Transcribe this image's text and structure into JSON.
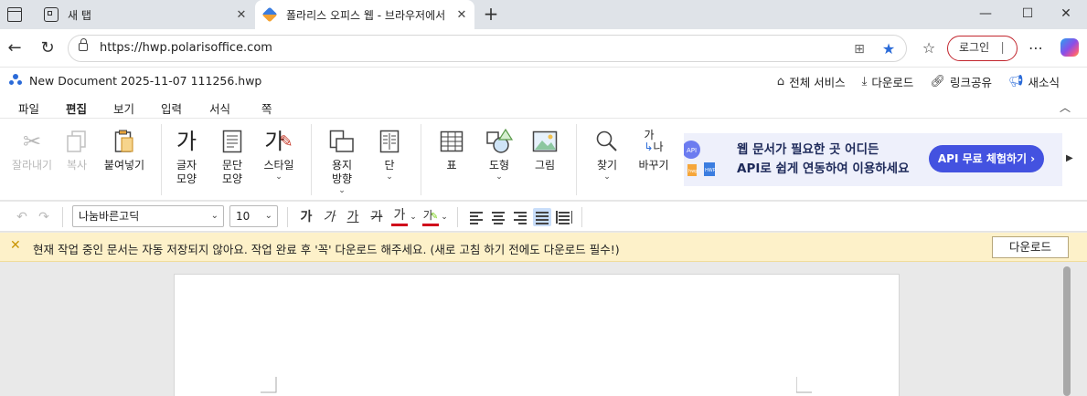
{
  "browser": {
    "tabs": [
      {
        "title": "새 탭",
        "favicon": "new-tab-icon"
      },
      {
        "title": "폴라리스 오피스 웹 - 브라우저에서",
        "favicon": "polaris-office-icon",
        "active": true
      }
    ],
    "url": "https://hwp.polarisoffice.com",
    "login_label": "로그인",
    "window_controls": {
      "minimize": "—",
      "maximize": "☐",
      "close": "✕"
    }
  },
  "app": {
    "doc_title": "New Document 2025-11-07 111256.hwp",
    "header_links": [
      {
        "label": "전체 서비스",
        "icon": "home-icon"
      },
      {
        "label": "다운로드",
        "icon": "download-icon"
      },
      {
        "label": "링크공유",
        "icon": "link-icon"
      },
      {
        "label": "새소식",
        "icon": "megaphone-icon"
      }
    ],
    "menu": [
      "파일",
      "편집",
      "보기",
      "입력",
      "서식",
      "쪽"
    ],
    "active_menu": "편집"
  },
  "ribbon": {
    "cut": "잘라내기",
    "copy": "복사",
    "paste": "붙여넣기",
    "char_shape": [
      "글자",
      "모양"
    ],
    "para_shape": [
      "문단",
      "모양"
    ],
    "style": "스타일",
    "page_orient": [
      "용지",
      "방향"
    ],
    "columns": "단",
    "table": "표",
    "shape": "도형",
    "picture": "그림",
    "find": "찾기",
    "replace": "바꾸기",
    "glyph_ga": "가",
    "glyph_na": "나"
  },
  "ad": {
    "line1": "웹 문서가 필요한 곳 어디든",
    "line2": "API로 쉽게 연동하여 이용하세요",
    "button": "API 무료 체험하기 ›",
    "api_tag": "API",
    "art_label_1": "hwp",
    "art_label_2": "HWP"
  },
  "format": {
    "font": "나눔바른고딕",
    "size": "10",
    "bold": "가",
    "italic": "가",
    "underline": "가",
    "strike": "가",
    "font_color": "가",
    "highlight": "가",
    "accent_red": "#d0021b",
    "accent_green": "#7ed321"
  },
  "warning": {
    "text": "현재 작업 중인 문서는 자동 저장되지 않아요. 작업 완료 후 '꼭' 다운로드 해주세요. (새로 고침 하기 전에도 다운로드 필수!)",
    "button": "다운로드"
  },
  "colors": {
    "accent_blue": "#2b6bd8",
    "ad_button": "#4352e0",
    "warning_bg": "#fdf1c9"
  }
}
